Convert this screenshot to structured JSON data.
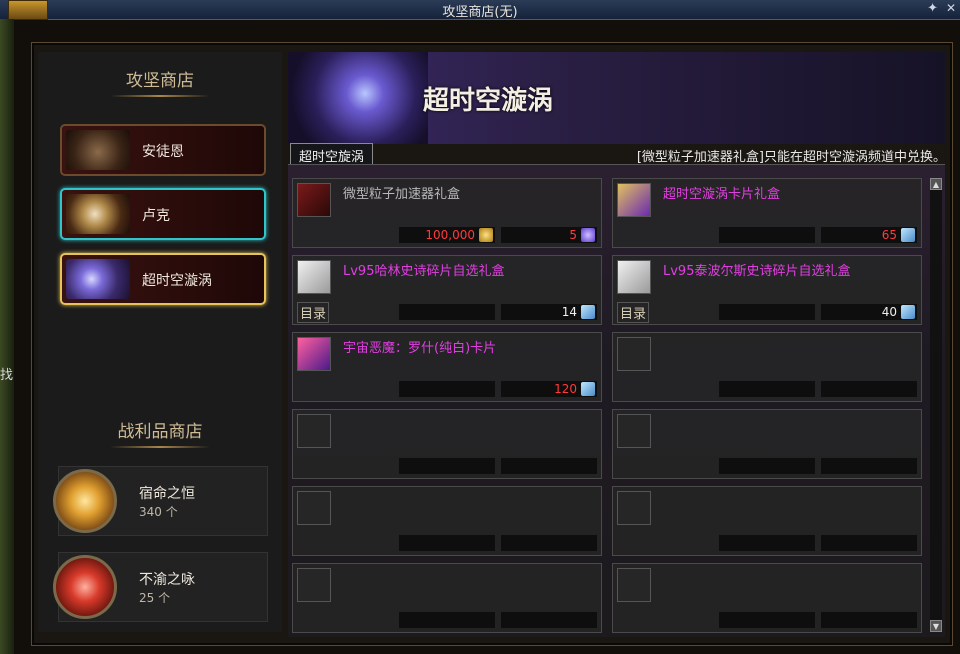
{
  "window": {
    "title": "攻坚商店(无)",
    "pin_glyph": "✦",
    "close_glyph": "✕"
  },
  "edge_text": "找",
  "left": {
    "shop_header": "攻坚商店",
    "npcs": [
      {
        "label": "安徒恩",
        "state": "normal"
      },
      {
        "label": "卢克",
        "state": "cyan"
      },
      {
        "label": "超时空漩涡",
        "state": "gold"
      }
    ],
    "loot_header": "战利品商店",
    "loot": [
      {
        "name": "宿命之恒",
        "count": "340 个",
        "color": "#e8b040"
      },
      {
        "name": "不渝之咏",
        "count": "25 个",
        "color": "#d83a2a"
      }
    ]
  },
  "banner": {
    "title": "超时空漩涡"
  },
  "tab": {
    "label": "超时空旋涡"
  },
  "notice": "[微型粒子加速器礼盒]只能在超时空漩涡频道中兑换。",
  "scroll": {
    "up": "▲",
    "down": "▼"
  },
  "items": [
    {
      "name": "微型粒子加速器礼盒",
      "name_color": "#b8b8b8",
      "icon": "red-box-icon",
      "mulu": "",
      "price1": "100,000",
      "price1_color": "#ff3a3a",
      "cur1": "gold-coin-icon",
      "price2": "5",
      "price2_color": "#ff3a3a",
      "cur2": "purple-orb-icon"
    },
    {
      "name": "超时空漩涡卡片礼盒",
      "name_color": "#e040e0",
      "icon": "gold-card-box-icon",
      "mulu": "",
      "price1": "",
      "price1_color": "#ff3a3a",
      "cur1": "",
      "price2": "65",
      "price2_color": "#ff3a3a",
      "cur2": "crystal-icon"
    },
    {
      "name": "Lv95哈林史诗碎片自选礼盒",
      "name_color": "#e040e0",
      "icon": "white-box-icon",
      "mulu": "目录",
      "price1": "",
      "price1_color": "#f0f0f0",
      "cur1": "",
      "price2": "14",
      "price2_color": "#f0f0f0",
      "cur2": "crystal-icon"
    },
    {
      "name": "Lv95泰波尔斯史诗碎片自选礼盒",
      "name_color": "#e040e0",
      "icon": "white-box-icon",
      "mulu": "目录",
      "price1": "",
      "price1_color": "#f0f0f0",
      "cur1": "",
      "price2": "40",
      "price2_color": "#f0f0f0",
      "cur2": "crystal-icon"
    },
    {
      "name": "宇宙恶魔：罗什(纯白)卡片",
      "name_color": "#e040e0",
      "icon": "card-icon",
      "mulu": "",
      "price1": "",
      "price1_color": "#ff3a3a",
      "cur1": "",
      "price2": "120",
      "price2_color": "#ff3a3a",
      "cur2": "crystal-icon"
    },
    {
      "name": "",
      "name_color": "",
      "icon": "",
      "mulu": "",
      "price1": "",
      "price1_color": "",
      "cur1": "",
      "price2": "",
      "price2_color": "",
      "cur2": ""
    },
    {
      "name": "",
      "name_color": "",
      "icon": "",
      "mulu": "",
      "price1": "",
      "price1_color": "",
      "cur1": "",
      "price2": "",
      "price2_color": "",
      "cur2": ""
    },
    {
      "name": "",
      "name_color": "",
      "icon": "",
      "mulu": "",
      "price1": "",
      "price1_color": "",
      "cur1": "",
      "price2": "",
      "price2_color": "",
      "cur2": ""
    },
    {
      "name": "",
      "name_color": "",
      "icon": "",
      "mulu": "",
      "price1": "",
      "price1_color": "",
      "cur1": "",
      "price2": "",
      "price2_color": "",
      "cur2": ""
    },
    {
      "name": "",
      "name_color": "",
      "icon": "",
      "mulu": "",
      "price1": "",
      "price1_color": "",
      "cur1": "",
      "price2": "",
      "price2_color": "",
      "cur2": ""
    },
    {
      "name": "",
      "name_color": "",
      "icon": "",
      "mulu": "",
      "price1": "",
      "price1_color": "",
      "cur1": "",
      "price2": "",
      "price2_color": "",
      "cur2": ""
    },
    {
      "name": "",
      "name_color": "",
      "icon": "",
      "mulu": "",
      "price1": "",
      "price1_color": "",
      "cur1": "",
      "price2": "",
      "price2_color": "",
      "cur2": ""
    }
  ]
}
